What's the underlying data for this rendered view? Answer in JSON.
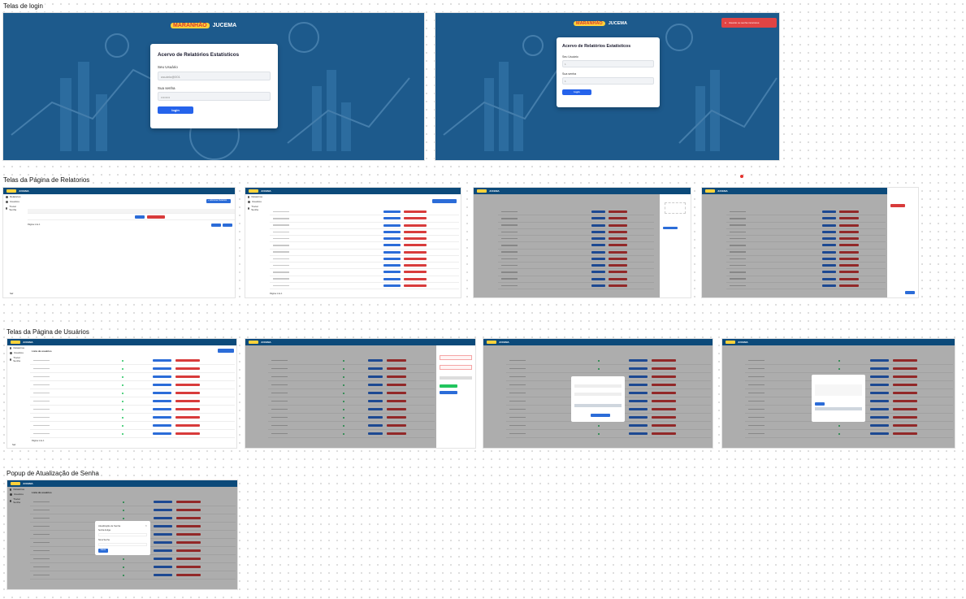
{
  "sections": {
    "login": "Telas de login",
    "reports": "Telas da Página de Relatorios",
    "users": "Telas da Página de Usuários",
    "popup": "Popup de Atualização de Senha"
  },
  "brand": {
    "logo_text": "MARANHÃO",
    "name": "JUCEMA"
  },
  "login": {
    "title": "Acervo de Relatórios Estatísticos",
    "user_label": "Seu Usuário",
    "user_value": "usuário@001",
    "pass_label": "Sua senha",
    "pass_value": "••••••••",
    "button": "login",
    "error_toast": "Usuário ou senha incorretos",
    "empty_user": "1",
    "empty_pass": "1"
  },
  "app": {
    "title": "JUCEMA",
    "sidebar": [
      "Relatórios",
      "Usuários",
      "Trocar Senha"
    ],
    "add_report": "+ Adicionar Relatório",
    "add_user": "+ Novo Usuário",
    "users_title": "Lista de usuários",
    "page_label": "Página 1 de 1",
    "prev": "Anterior",
    "next": "Próximo",
    "exit": "Sair"
  },
  "password_popup": {
    "title": "Atualização de Senha",
    "field1": "Senha Antiga",
    "field2": "Nova Senha",
    "button": "Salvar"
  },
  "colors": {
    "brand_blue": "#0c4a7a",
    "login_bg": "#1d5a8c",
    "primary": "#2563eb",
    "danger": "#d83b3b"
  }
}
